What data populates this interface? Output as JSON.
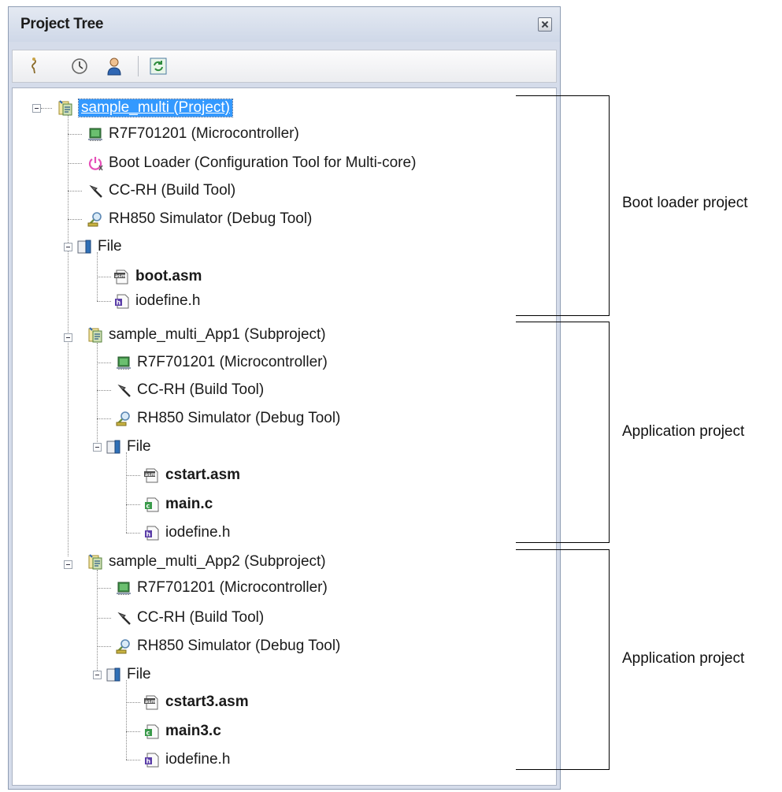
{
  "panel": {
    "title": "Project Tree"
  },
  "toolbar": {
    "buttons": [
      {
        "name": "property-button",
        "icon": "wand-icon"
      },
      {
        "name": "history-button",
        "icon": "clock-icon"
      },
      {
        "name": "person-button",
        "icon": "person-icon"
      },
      {
        "name": "refresh-button",
        "icon": "refresh-icon"
      }
    ]
  },
  "tree": {
    "project": {
      "label": "sample_multi (Project)",
      "icon": "project-icon"
    },
    "boot": {
      "microcontroller": "R7F701201 (Microcontroller)",
      "boot_loader": "Boot Loader (Configuration Tool for Multi-core)",
      "build_tool": "CC-RH (Build Tool)",
      "debug_tool": "RH850 Simulator (Debug Tool)",
      "file_folder": "File",
      "files": [
        "boot.asm",
        "iodefine.h"
      ]
    },
    "app1": {
      "label": "sample_multi_App1 (Subproject)",
      "microcontroller": "R7F701201 (Microcontroller)",
      "build_tool": "CC-RH (Build Tool)",
      "debug_tool": "RH850 Simulator (Debug Tool)",
      "file_folder": "File",
      "files": [
        "cstart.asm",
        "main.c",
        "iodefine.h"
      ]
    },
    "app2": {
      "label": "sample_multi_App2 (Subproject)",
      "microcontroller": "R7F701201 (Microcontroller)",
      "build_tool": "CC-RH (Build Tool)",
      "debug_tool": "RH850 Simulator (Debug Tool)",
      "file_folder": "File",
      "files": [
        "cstart3.asm",
        "main3.c",
        "iodefine.h"
      ]
    }
  },
  "annotations": {
    "boot_loader_project": "Boot loader project",
    "application_project_1": "Application project",
    "application_project_2": "Application project"
  }
}
